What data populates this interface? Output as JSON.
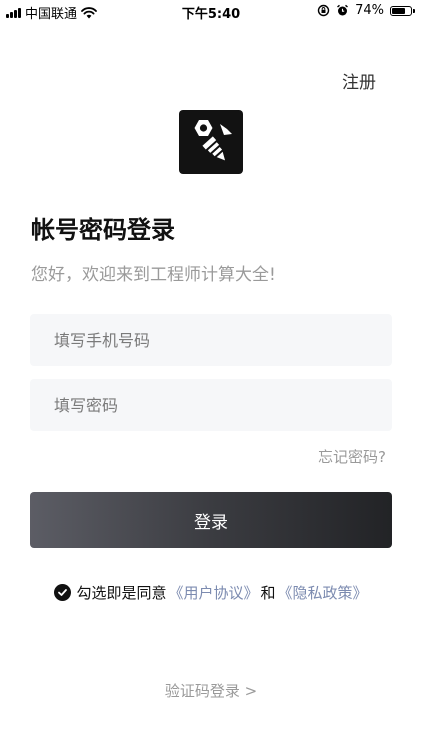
{
  "status_bar": {
    "carrier": "中国联通",
    "time": "下午5:40",
    "battery": "74%",
    "battery_level": 0.74,
    "icons": [
      "signal-icon",
      "wifi-icon",
      "rotation-lock-icon",
      "alarm-icon",
      "battery-icon"
    ]
  },
  "header": {
    "register": "注册"
  },
  "logo": {
    "icon": "nut-and-screw-logo-icon",
    "background": "#121212"
  },
  "title": "帐号密码登录",
  "welcome": "您好，欢迎来到工程师计算大全!",
  "form": {
    "phone_placeholder": "填写手机号码",
    "phone_value": "",
    "password_placeholder": "填写密码",
    "password_value": "",
    "forgot": "忘记密码?",
    "login": "登录"
  },
  "agreement": {
    "prefix": "勾选即是同意",
    "user_agreement": "《用户协议》",
    "and": "和",
    "privacy_policy": "《隐私政策》",
    "link_color": "#7c8bb0",
    "checked": true
  },
  "sms_login": "验证码登录 >"
}
